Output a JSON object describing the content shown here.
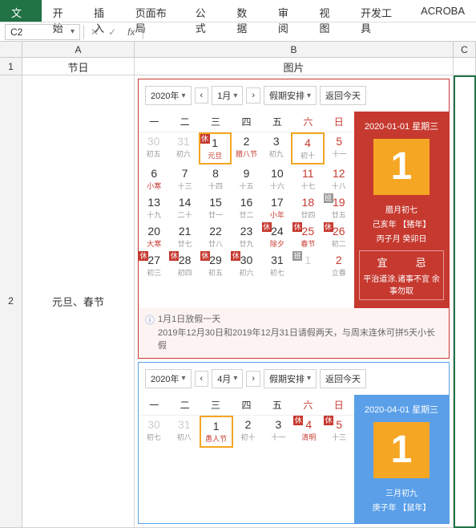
{
  "ribbon": {
    "tabs": [
      "文件",
      "开始",
      "插入",
      "页面布局",
      "公式",
      "数据",
      "审阅",
      "视图",
      "开发工具",
      "ACROBA"
    ]
  },
  "formula": {
    "cell": "C2",
    "fx": "fx"
  },
  "cols": {
    "a": "A",
    "b": "B",
    "c": "C"
  },
  "rows": {
    "r1": "1",
    "r2": "2"
  },
  "header": {
    "a": "节日",
    "b": "图片"
  },
  "row1": {
    "a": "元旦、春节"
  },
  "cal1": {
    "year": "2020年",
    "month": "1月",
    "holiday": "假期安排",
    "today": "返回今天",
    "week": [
      "一",
      "二",
      "三",
      "四",
      "五",
      "六",
      "日"
    ],
    "side": {
      "date": "2020-01-01 星期三",
      "big": "1",
      "l1": "腊月初七",
      "l2": "己亥年 【猪年】",
      "l3": "丙子月 癸卯日",
      "yi": "宜",
      "ji": "忌",
      "txt": "平治道涂.诸事不宜 余事勿取"
    },
    "tip1": "1月1日放假一天",
    "tip2": "2019年12月30日和2019年12月31日请假两天，与周末连休可拼5天小长假",
    "days": [
      [
        {
          "n": "30",
          "s": "初五",
          "dim": 1
        },
        {
          "n": "31",
          "s": "初六",
          "dim": 1
        },
        {
          "n": "1",
          "s": "元旦",
          "rest": 1,
          "today": 1,
          "fest": 1
        },
        {
          "n": "2",
          "s": "腊八节",
          "fest": 1
        },
        {
          "n": "3",
          "s": "初九"
        },
        {
          "n": "4",
          "s": "初十",
          "we": 1,
          "today": 1
        },
        {
          "n": "5",
          "s": "十一",
          "we": 1
        }
      ],
      [
        {
          "n": "6",
          "s": "小寒",
          "solar": 1
        },
        {
          "n": "7",
          "s": "十三"
        },
        {
          "n": "8",
          "s": "十四"
        },
        {
          "n": "9",
          "s": "十五"
        },
        {
          "n": "10",
          "s": "十六"
        },
        {
          "n": "11",
          "s": "十七",
          "we": 1
        },
        {
          "n": "12",
          "s": "十八",
          "we": 1
        }
      ],
      [
        {
          "n": "13",
          "s": "十九"
        },
        {
          "n": "14",
          "s": "二十"
        },
        {
          "n": "15",
          "s": "廿一"
        },
        {
          "n": "16",
          "s": "廿二"
        },
        {
          "n": "17",
          "s": "小年",
          "fest": 1
        },
        {
          "n": "18",
          "s": "廿四",
          "we": 1
        },
        {
          "n": "19",
          "s": "廿五",
          "we": 1,
          "work": 1
        }
      ],
      [
        {
          "n": "20",
          "s": "大寒",
          "solar": 1
        },
        {
          "n": "21",
          "s": "廿七"
        },
        {
          "n": "22",
          "s": "廿八"
        },
        {
          "n": "23",
          "s": "廿九"
        },
        {
          "n": "24",
          "s": "除夕",
          "rest": 1,
          "fest": 1
        },
        {
          "n": "25",
          "s": "春节",
          "rest": 1,
          "we": 1,
          "fest": 1
        },
        {
          "n": "26",
          "s": "初二",
          "rest": 1,
          "we": 1
        }
      ],
      [
        {
          "n": "27",
          "s": "初三",
          "rest": 1
        },
        {
          "n": "28",
          "s": "初四",
          "rest": 1
        },
        {
          "n": "29",
          "s": "初五",
          "rest": 1
        },
        {
          "n": "30",
          "s": "初六",
          "rest": 1
        },
        {
          "n": "31",
          "s": "初七"
        },
        {
          "n": "1",
          "s": "",
          "dim": 1,
          "work": 1
        },
        {
          "n": "2",
          "s": "立春",
          "dim": 1,
          "we": 1
        }
      ]
    ]
  },
  "cal2": {
    "year": "2020年",
    "month": "4月",
    "holiday": "假期安排",
    "today": "返回今天",
    "week": [
      "一",
      "二",
      "三",
      "四",
      "五",
      "六",
      "日"
    ],
    "side": {
      "date": "2020-04-01 星期三",
      "big": "1",
      "l1": "三月初九",
      "l2": "庚子年 【鼠年】"
    },
    "days": [
      [
        {
          "n": "30",
          "s": "初七",
          "dim": 1
        },
        {
          "n": "31",
          "s": "初八",
          "dim": 1
        },
        {
          "n": "1",
          "s": "愚人节",
          "today": 1,
          "fest": 1
        },
        {
          "n": "2",
          "s": "初十"
        },
        {
          "n": "3",
          "s": "十一"
        },
        {
          "n": "4",
          "s": "清明",
          "rest": 1,
          "we": 1,
          "fest": 1
        },
        {
          "n": "5",
          "s": "十三",
          "rest": 1,
          "we": 1
        }
      ]
    ]
  }
}
